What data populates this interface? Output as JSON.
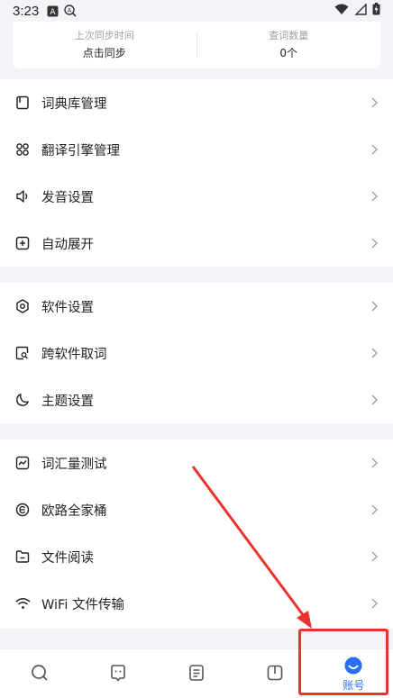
{
  "status_bar": {
    "time": "3:23",
    "icons": [
      "a-box-icon",
      "a-search-icon",
      "wifi-icon",
      "signal-icon",
      "battery-charging-icon"
    ]
  },
  "sync": {
    "last_sync_label": "上次同步时间",
    "last_sync_value": "点击同步",
    "lookup_count_label": "查词数量",
    "lookup_count_value": "0个"
  },
  "groups": [
    {
      "items": [
        {
          "label": "词典库管理",
          "icon": "book-icon"
        },
        {
          "label": "翻译引擎管理",
          "icon": "grid-icon"
        },
        {
          "label": "发音设置",
          "icon": "speaker-icon"
        },
        {
          "label": "自动展开",
          "icon": "plus-square-icon"
        }
      ]
    },
    {
      "items": [
        {
          "label": "软件设置",
          "icon": "settings-hex-icon"
        },
        {
          "label": "跨软件取词",
          "icon": "search-doc-icon"
        },
        {
          "label": "主题设置",
          "icon": "moon-icon"
        }
      ]
    },
    {
      "items": [
        {
          "label": "词汇量测试",
          "icon": "chart-icon"
        },
        {
          "label": "欧路全家桶",
          "icon": "circle-e-icon"
        },
        {
          "label": "文件阅读",
          "icon": "folder-icon"
        },
        {
          "label": "WiFi 文件传输",
          "icon": "wifi-icon"
        }
      ]
    }
  ],
  "tabbar": {
    "tabs": [
      {
        "label": "",
        "icon": "search-icon"
      },
      {
        "label": "",
        "icon": "chat-icon"
      },
      {
        "label": "",
        "icon": "notes-icon"
      },
      {
        "label": "",
        "icon": "open-book-icon"
      },
      {
        "label": "账号",
        "icon": "account-smile-icon",
        "active": true
      }
    ]
  },
  "colors": {
    "accent": "#2a6ef5",
    "annotation": "#e8342c",
    "page_bg": "#f2f4f7"
  }
}
